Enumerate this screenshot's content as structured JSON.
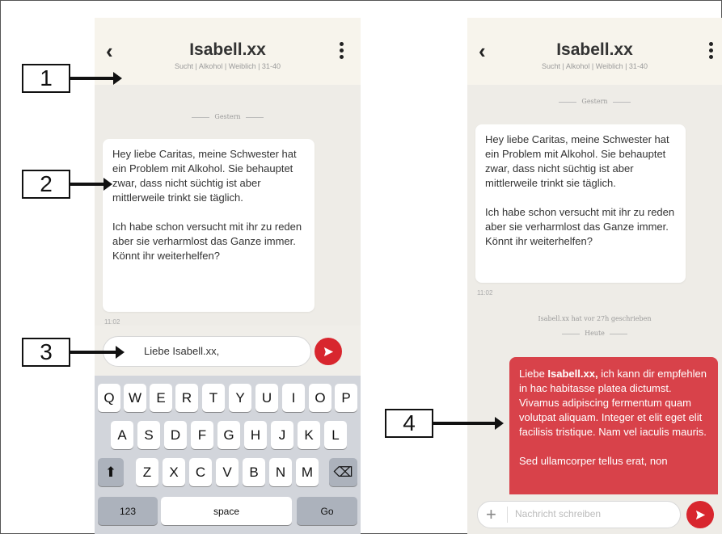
{
  "chat": {
    "title": "Isabell.xx",
    "subtitle": "Sucht | Alkohol | Weiblich | 31-40",
    "divider_yesterday": "Gestern",
    "divider_today": "Heute",
    "msg_p1": "Hey liebe Caritas, meine Schwester hat ein Problem mit Alkohol. Sie behauptet zwar, dass nicht süchtig ist aber mittlerweile trinkt sie täglich.",
    "msg_p2": "Ich habe schon versucht mit ihr zu reden aber sie verharmlost das Ganze immer. Könnt ihr weiterhelfen?",
    "msg_time": "11:02",
    "wrote_info": "Isabell.xx hat vor 27h geschrieben",
    "reply_prefix": "Liebe ",
    "reply_name": "Isabell.xx,",
    "reply_rest": " ich kann dir empfehlen in hac habitasse platea dictumst. Vivamus adipiscing fermentum quam volutpat aliquam. Integer et elit eget elit facilisis tristique. Nam vel iaculis mauris.",
    "reply_cut": "Sed ullamcorper tellus erat, non"
  },
  "composer": {
    "draft": "Liebe Isabell.xx,",
    "placeholder": "Nachricht schreiben"
  },
  "keyboard": {
    "row1": [
      "Q",
      "W",
      "E",
      "R",
      "T",
      "Y",
      "U",
      "I",
      "O",
      "P"
    ],
    "row2": [
      "A",
      "S",
      "D",
      "F",
      "G",
      "H",
      "J",
      "K",
      "L"
    ],
    "row3": [
      "Z",
      "X",
      "C",
      "V",
      "B",
      "N",
      "M"
    ],
    "shift": "⬆",
    "delete": "⌫",
    "numbers": "123",
    "space": "space",
    "go": "Go"
  },
  "icons": {
    "back": "‹",
    "plus": "+"
  },
  "callouts": [
    "1",
    "2",
    "3",
    "4"
  ],
  "colors": {
    "accent_red": "#d8262e",
    "bubble_red": "#d8424a",
    "header_bg": "#f7f4ec",
    "chat_bg": "#eeece7"
  }
}
